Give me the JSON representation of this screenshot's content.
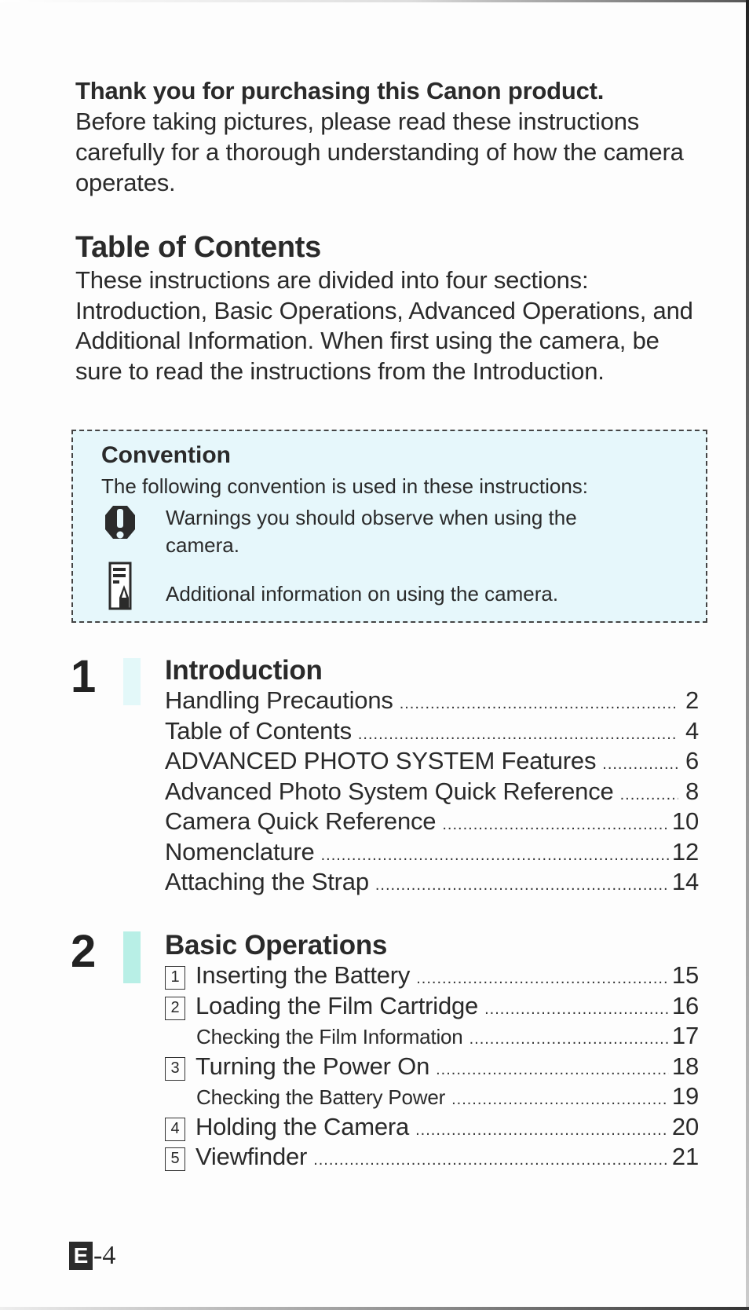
{
  "intro": {
    "lead": "Thank you for purchasing this Canon product.",
    "body": "Before taking pictures, please read these instructions carefully for a thorough understanding of how the camera operates."
  },
  "toc": {
    "title": "Table of Contents",
    "description": "These instructions are divided into four sections: Introduction, Basic Operations, Advanced Operations, and Additional Information. When first using the camera, be sure to read the instructions from the Introduction."
  },
  "convention": {
    "title": "Convention",
    "description": "The following convention is used in these instructions:",
    "items": [
      {
        "icon": "warning-icon",
        "text": "Warnings you should observe when using the camera."
      },
      {
        "icon": "memo-icon",
        "text": "Additional information on using the camera."
      }
    ]
  },
  "sections": [
    {
      "number": "1",
      "heading": "Introduction",
      "bar_color": "#e3f8f9",
      "items": [
        {
          "label": "Handling Precautions",
          "page": "2"
        },
        {
          "label": "Table of Contents",
          "page": "4"
        },
        {
          "label": "ADVANCED PHOTO SYSTEM Features",
          "page": "6"
        },
        {
          "label": "Advanced Photo System Quick Reference",
          "page": "8"
        },
        {
          "label": "Camera Quick Reference",
          "page": "10"
        },
        {
          "label": "Nomenclature",
          "page": "12"
        },
        {
          "label": "Attaching the Strap",
          "page": "14"
        }
      ]
    },
    {
      "number": "2",
      "heading": "Basic Operations",
      "bar_color": "#b8efe6",
      "items": [
        {
          "step": "1",
          "label": "Inserting the Battery",
          "page": "15"
        },
        {
          "step": "2",
          "label": "Loading the Film Cartridge",
          "page": "16"
        },
        {
          "step": "",
          "label": "Checking the Film Information",
          "page": "17",
          "sub": true
        },
        {
          "step": "3",
          "label": "Turning the Power On",
          "page": "18"
        },
        {
          "step": "",
          "label": "Checking the Battery Power",
          "page": "19",
          "sub": true
        },
        {
          "step": "4",
          "label": "Holding the Camera",
          "page": "20"
        },
        {
          "step": "5",
          "label": "Viewfinder",
          "page": "21"
        }
      ]
    }
  ],
  "footer": {
    "language_badge": "E",
    "page_number": "-4"
  },
  "colors": {
    "convention_bg": "#e6f7fb",
    "text": "#2a2a2a"
  }
}
